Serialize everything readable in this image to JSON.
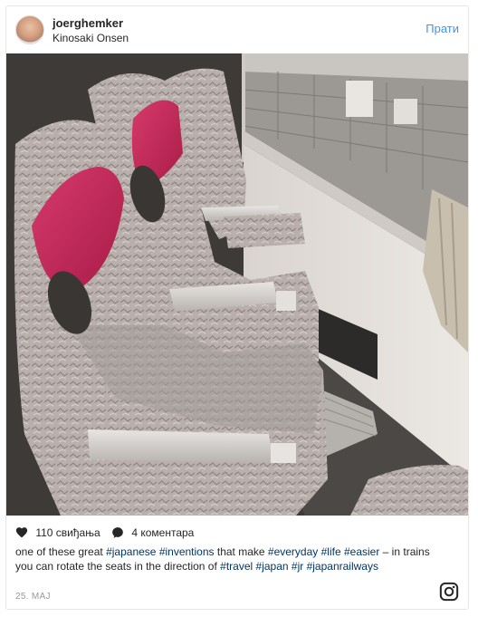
{
  "post": {
    "username": "joerghemker",
    "location": "Kinosaki Onsen",
    "follow_label": "Прати",
    "likes": "110 свиђања",
    "comments": "4 коментара",
    "caption": {
      "t1": "one of these great ",
      "tag_japanese": "#japanese",
      "t2": " ",
      "tag_inventions": "#inventions",
      "t3": " that make ",
      "tag_everyday": "#everyday",
      "t4": " ",
      "tag_life": "#life",
      "t5": " ",
      "tag_easier": "#easier",
      "t6": " – in trains you can rotate the seats in the direction of ",
      "tag_travel": "#travel",
      "t7": " ",
      "tag_japan": "#japan",
      "t8": " ",
      "tag_jr": "#jr",
      "t9": " ",
      "tag_japanrailways": "#japanrailways"
    },
    "date": "25. МАЈ"
  },
  "icons": {
    "heart": "heart-icon",
    "comment": "comment-bubble-icon",
    "instagram": "instagram-logo"
  },
  "colors": {
    "link_blue": "#3897f0",
    "hashtag": "#003569",
    "text": "#262626",
    "muted": "#999999",
    "headrest_pink": "#c8245a"
  }
}
